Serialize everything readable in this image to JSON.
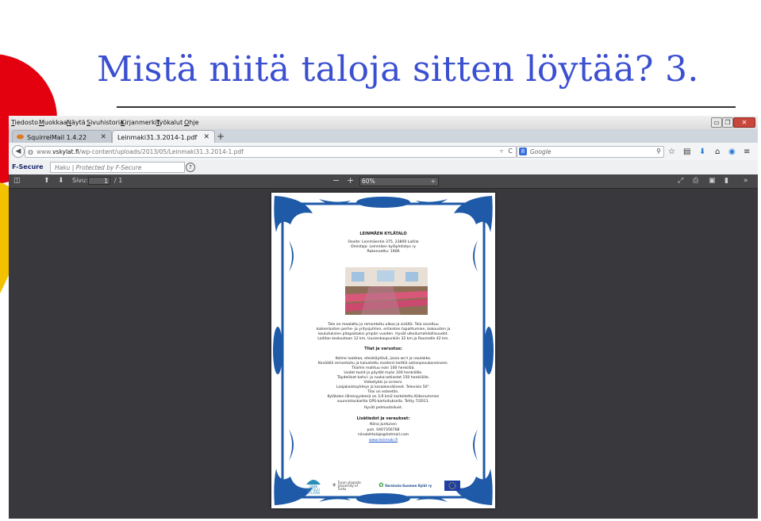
{
  "slide": {
    "title": "Mistä niitä taloja sitten löytää? 3.",
    "colors": {
      "title": "#3b4fd1",
      "accent_red": "#e3000f",
      "accent_yellow": "#f2c100"
    }
  },
  "browser": {
    "menu": [
      "Tiedosto",
      "Muokkaa",
      "Näytä",
      "Sivuhistoria",
      "Kirjanmerkit",
      "Työkalut",
      "Ohje"
    ],
    "window_buttons": {
      "minimize": "▭",
      "restore": "❐",
      "close": "✕"
    },
    "tabs": [
      {
        "label": "SquirrelMail 1.4.22",
        "close": "✕"
      },
      {
        "label": "Leinmaki31.3.2014-1.pdf",
        "close": "✕"
      }
    ],
    "new_tab": "+",
    "url": {
      "prefix": "www.",
      "domain": "vskylat.fi",
      "path": "/wp-content/uploads/2013/05/Leinmaki31.3.2014-1.pdf"
    },
    "search_engine": "Google",
    "security": {
      "brand": "F-Secure",
      "placeholder": "Haku | Protected by F-Secure",
      "help": "?"
    }
  },
  "pdf_viewer": {
    "page_label": "Sivu:",
    "current_page": "1",
    "total_pages": "/ 1",
    "zoom": "60%",
    "zoom_out": "−",
    "zoom_in": "+",
    "zoom_arrow": "÷"
  },
  "document": {
    "title": "LEINMÄEN KYLÄTALO",
    "address": "Osoite: Leinmäentie 375, 23800 Laitila",
    "owner": "Omistaja: Leinmäen kyläyhdistys ry",
    "built": "Rakennettu: 1906",
    "intro": [
      "Talo on maalattu ja remontoitu ulkoa ja sisältä. Talo soveltuu",
      "kaikenlaisten perhe- ja yritysjuhlien, erilaisten tapahtumien, kokousten ja",
      "koulutuksien pitopaikaksi ympäri vuoden. Hyvät ulkoilumahdollisuudet.",
      "Laitilan keskustaan 12 km, Uusienkaupunkiin 32 km ja Raumalle 42 km."
    ],
    "facilities_heading": "Tilat ja varustus:",
    "facilities": [
      "Kolme luokkaa, eteiskäytävä, jossa wc:t ja naulakko.",
      "Keväällä remontoitu ja kalustettu moderni keittiö astianpesukoneineen.",
      "Tilaihin mahtuu noin 100 henkilöä.",
      "Uudet tuolit ja pöydät myös 100 henkilölle.",
      "Täydelliset kahvi- ja ruoka-astiastot 150 henkilölle.",
      "Videotykki ja screeni.",
      "Laajakaistayhteys ja karaokevälineet. Televisio 50\".",
      "Tilai on esteetön.",
      "Kylätalon läheisyydessä on 3,9 km2 kartoitettu Kilkonummen",
      "suunnistuskartta GPS-kartoituksella. Tehty 7/2011.",
      "Hyvät pelmuotoiluet."
    ],
    "contact_heading": "Lisätiedot ja varaukset:",
    "contact": [
      "Niina Juntunen",
      "puh. 0407356768",
      "niinalehtolaje@hotmail.com"
    ],
    "website": "www.leinmaki.fi",
    "logos": [
      "ONNI KUTSUU KYLÄÄN",
      "Turun yliopisto University of Turku",
      "Varsinais-Suomen Kylät ry"
    ]
  }
}
